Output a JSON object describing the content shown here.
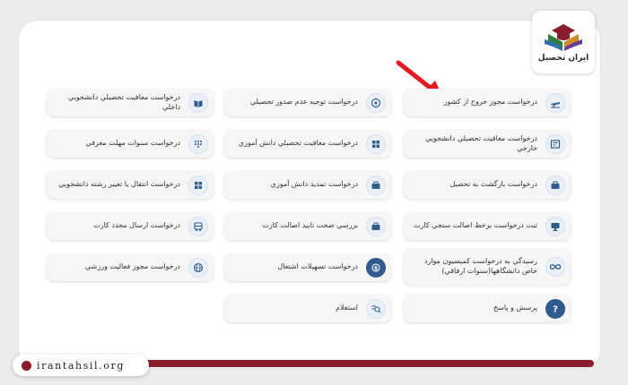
{
  "logo": {
    "text": "ایران تحصیل"
  },
  "footer": {
    "site": "irantahsil.org"
  },
  "accent_color": "#2f5b8e",
  "brand_color": "#8b1c2c",
  "services": {
    "col1": [
      {
        "label": "درخواست مجوز خروج از کشور",
        "icon": "airplane-icon"
      },
      {
        "label": "درخواست معافيت تحصيلي دانشجويي خارجي",
        "icon": "certificate-icon"
      },
      {
        "label": "درخواست بازگشت به تحصيل",
        "icon": "briefcase-icon"
      },
      {
        "label": "ثبت درخواست برخط اصالت سنجي كارت",
        "icon": "monitor-icon"
      },
      {
        "label": "رسيدگي به درخواست كميسيون موارد خاص دانشگاهها(سنوات ارفاقي)",
        "icon": "infinity-icon"
      },
      {
        "label": "پرسش و پاسخ",
        "icon": "question-icon"
      }
    ],
    "col2": [
      {
        "label": "درخواست توجيه عدم صدور تحصيلي",
        "icon": "compass-icon"
      },
      {
        "label": "درخواست معافيت تحصيلي دانش آموزي",
        "icon": "grid-icon"
      },
      {
        "label": "درخواست تمديد دانش آموزي",
        "icon": "briefcase-icon"
      },
      {
        "label": "بررسي صحت تاييد اصالت كارت",
        "icon": "briefcase-icon"
      },
      {
        "label": "درخواست تسهيلات اشتغال",
        "icon": "coin-icon"
      },
      {
        "label": "استعلام",
        "icon": "inquiry-icon"
      }
    ],
    "col3": [
      {
        "label": "درخواست معافيت تحصيلي دانشجويي داخلي",
        "icon": "book-icon"
      },
      {
        "label": "درخواست سنوات مهلت معرفي",
        "icon": "dial-icon"
      },
      {
        "label": "درخواست انتقال يا تغيير رشته دانشجويي",
        "icon": "grid-icon"
      },
      {
        "label": "درخواست ارسال مجدد كارت",
        "icon": "bus-icon"
      },
      {
        "label": "درخواست مجوز فعاليت ورزشي",
        "icon": "globe-icon"
      }
    ]
  }
}
